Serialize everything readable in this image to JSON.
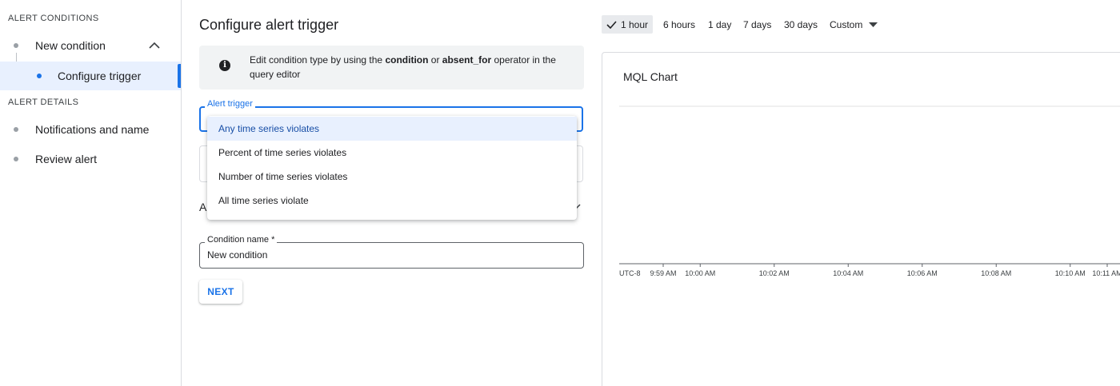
{
  "sidebar": {
    "alert_conditions_label": "ALERT CONDITIONS",
    "new_condition": "New condition",
    "configure_trigger": "Configure trigger",
    "alert_details_label": "ALERT DETAILS",
    "notifications_and_name": "Notifications and name",
    "review_alert": "Review alert"
  },
  "main": {
    "title": "Configure alert trigger",
    "info": {
      "part1": "Edit condition type by using the ",
      "bold1": "condition",
      "part2": " or ",
      "bold2": "absent_for",
      "part3": " operator in the query editor"
    },
    "alert_trigger_label": "Alert trigger",
    "options": [
      "Any time series violates",
      "Percent of time series violates",
      "Number of time series violates",
      "All time series violate"
    ],
    "partial_label": "A",
    "condition_name_label": "Condition name *",
    "condition_name_value": "New condition",
    "next_label": "NEXT"
  },
  "time_range": {
    "options": [
      "1 hour",
      "6 hours",
      "1 day",
      "7 days",
      "30 days",
      "Custom"
    ],
    "selected": "1 hour"
  },
  "chart": {
    "title": "MQL Chart",
    "timezone": "UTC-8",
    "tick_labels": [
      "9:59 AM",
      "10:00 AM",
      "10:02 AM",
      "10:04 AM",
      "10:06 AM",
      "10:08 AM",
      "10:10 AM",
      "10:11 AM"
    ]
  },
  "colors": {
    "accent": "#1a73e8",
    "selected_bg": "#e8f0fe",
    "border": "#dadce0"
  }
}
